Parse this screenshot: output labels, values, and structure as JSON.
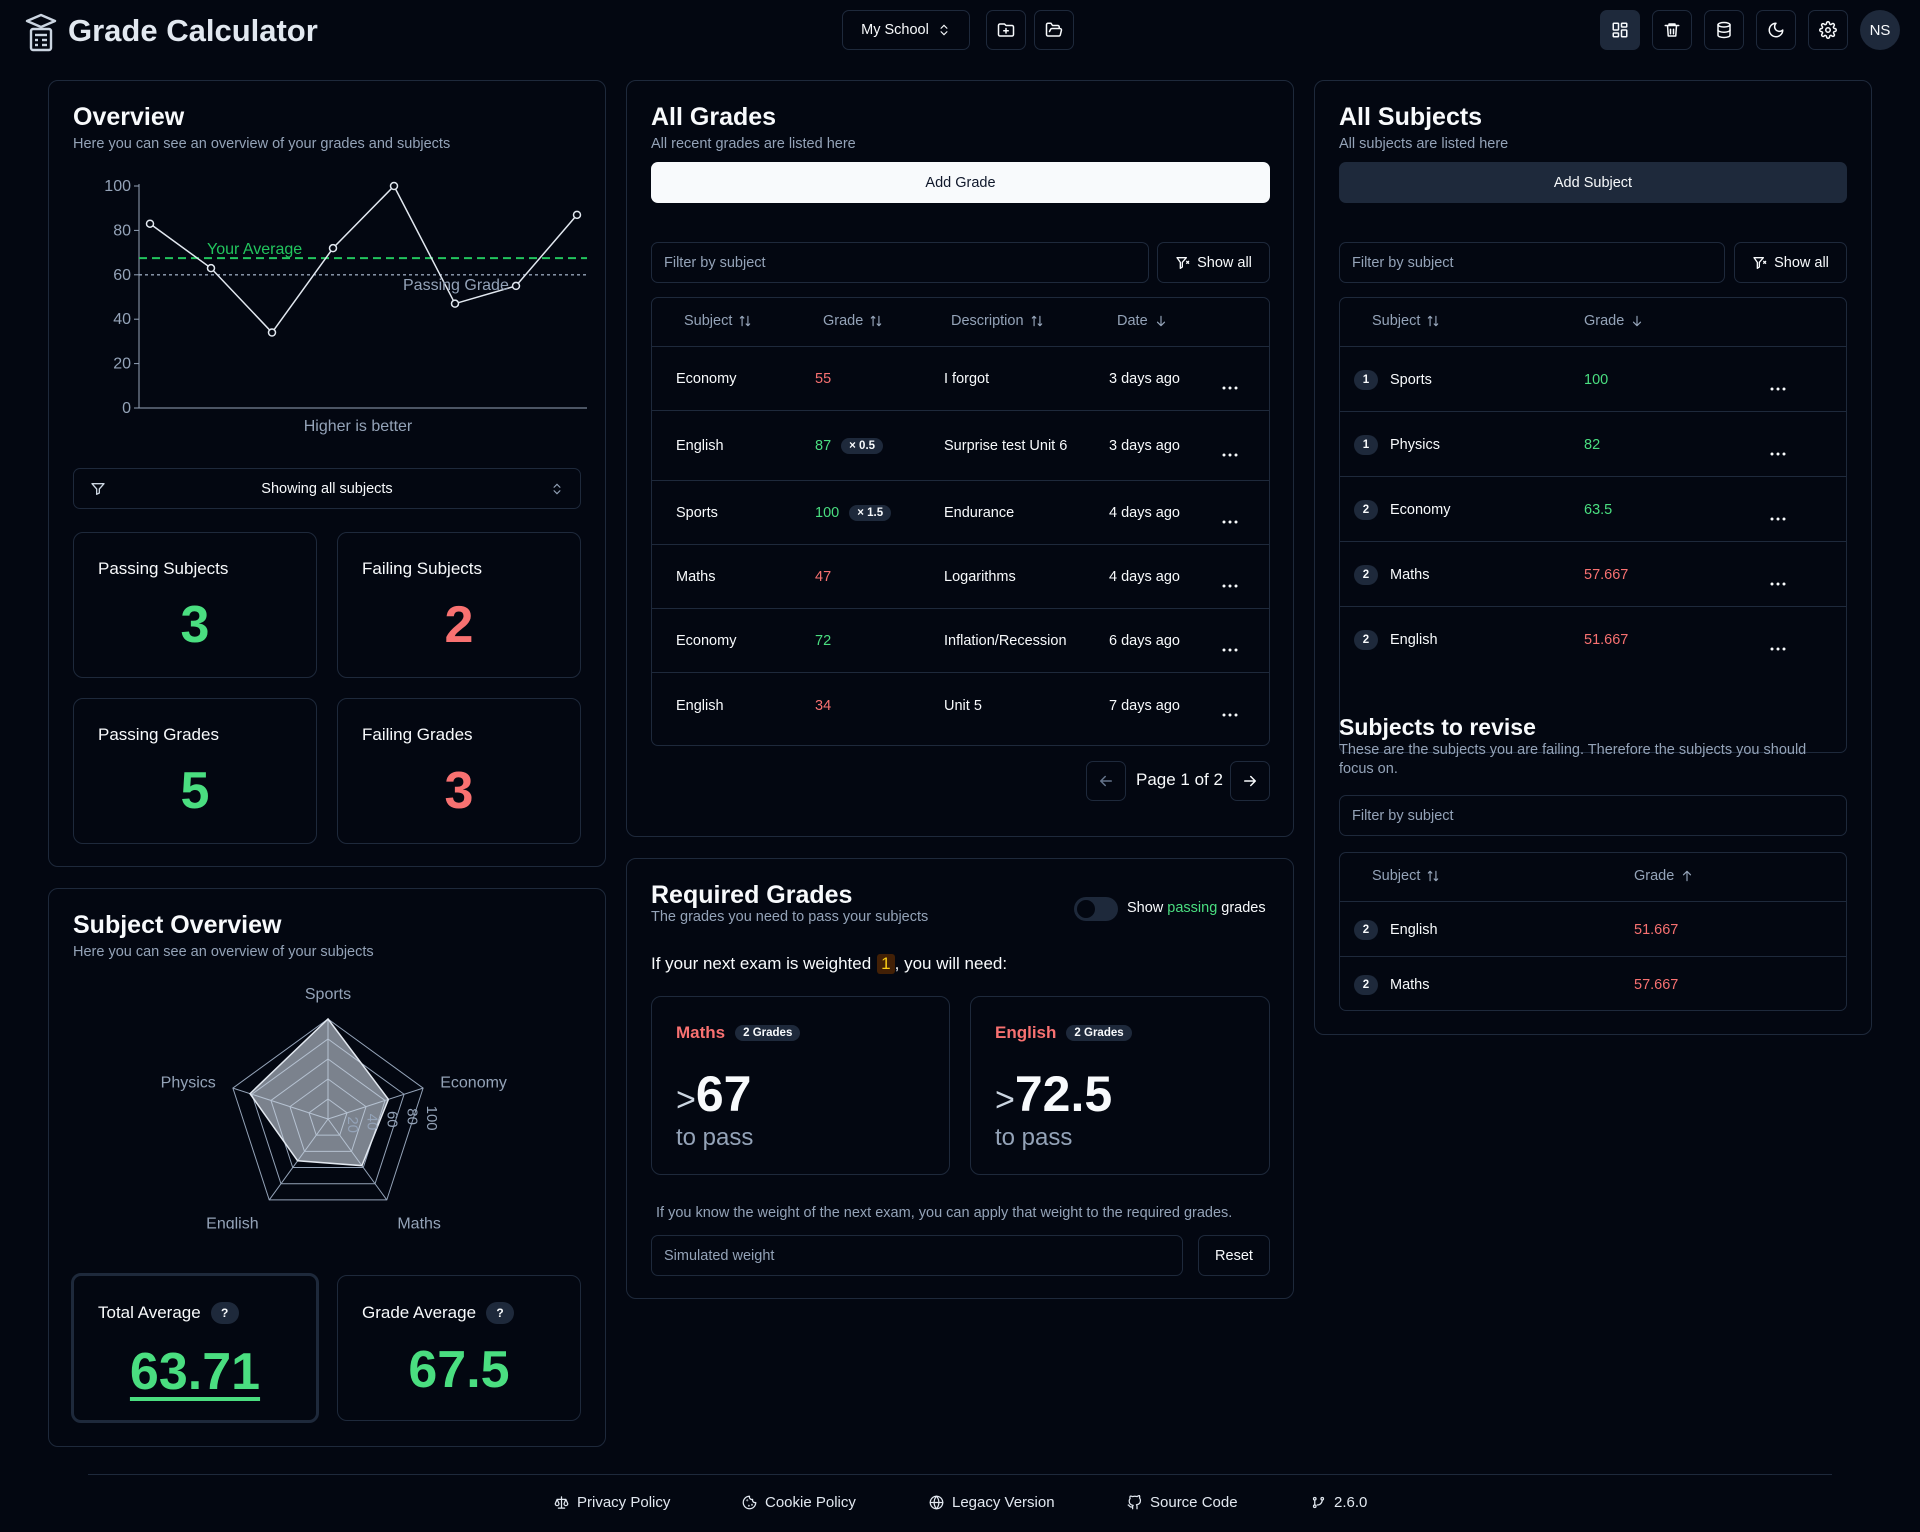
{
  "header": {
    "app_title": "Grade Calculator",
    "school_select": "My School",
    "user_initials": "NS"
  },
  "overview": {
    "title": "Overview",
    "subtitle": "Here you can see an overview of your grades and subjects",
    "filter_label": "Showing all subjects",
    "stats": {
      "passing_subjects_label": "Passing Subjects",
      "passing_subjects_value": "3",
      "failing_subjects_label": "Failing Subjects",
      "failing_subjects_value": "2",
      "passing_grades_label": "Passing Grades",
      "passing_grades_value": "5",
      "failing_grades_label": "Failing Grades",
      "failing_grades_value": "3"
    }
  },
  "chart_data": [
    {
      "type": "line",
      "y": [
        83,
        63,
        34,
        72,
        100,
        47,
        55,
        87
      ],
      "ylim": [
        0,
        100
      ],
      "yticks": [
        "100",
        "80",
        "60",
        "40",
        "20",
        "0"
      ],
      "xlabel": "Higher is better",
      "reference_lines": [
        {
          "name": "Your Average",
          "value": 67.5,
          "color": "#22c55e",
          "style": "dashed"
        },
        {
          "name": "Passing Grade",
          "value": 60,
          "color": "#94a3b8",
          "style": "dotted"
        }
      ],
      "grid": false
    },
    {
      "type": "radar",
      "categories": [
        "Sports",
        "Economy",
        "Maths",
        "English",
        "Physics"
      ],
      "values": [
        100,
        63.5,
        57.667,
        51.667,
        82
      ],
      "rlim": [
        0,
        100
      ],
      "rticks": [
        "20",
        "40",
        "60",
        "80",
        "100"
      ]
    }
  ],
  "subject_overview": {
    "title": "Subject Overview",
    "subtitle": "Here you can see an overview of your subjects",
    "total_average_label": "Total Average",
    "total_average_value": "63.71",
    "grade_average_label": "Grade Average",
    "grade_average_value": "67.5",
    "help_mark": "?"
  },
  "all_grades": {
    "title": "All Grades",
    "subtitle": "All recent grades are listed here",
    "add_button": "Add Grade",
    "filter_placeholder": "Filter by subject",
    "show_all": "Show all",
    "columns": [
      "Subject",
      "Grade",
      "Description",
      "Date"
    ],
    "rows": [
      {
        "subject": "Economy",
        "grade": "55",
        "weight": "",
        "description": "I forgot",
        "date": "3 days ago",
        "passing": false
      },
      {
        "subject": "English",
        "grade": "87",
        "weight": "× 0.5",
        "description": "Surprise test Unit 6",
        "date": "3 days ago",
        "passing": true
      },
      {
        "subject": "Sports",
        "grade": "100",
        "weight": "× 1.5",
        "description": "Endurance",
        "date": "4 days ago",
        "passing": true
      },
      {
        "subject": "Maths",
        "grade": "47",
        "weight": "",
        "description": "Logarithms",
        "date": "4 days ago",
        "passing": false
      },
      {
        "subject": "Economy",
        "grade": "72",
        "weight": "",
        "description": "Inflation/Recession",
        "date": "6 days ago",
        "passing": true
      },
      {
        "subject": "English",
        "grade": "34",
        "weight": "",
        "description": "Unit 5",
        "date": "7 days ago",
        "passing": false
      }
    ],
    "pagination": "Page 1 of 2"
  },
  "required_grades": {
    "title": "Required Grades",
    "subtitle": "The grades you need to pass your subjects",
    "toggle_prefix": "Show",
    "toggle_highlight": "passing",
    "toggle_suffix": "grades",
    "weight_text_before": "If your next exam is weighted",
    "weight_value": "1",
    "weight_text_after": ", you will need:",
    "cards": [
      {
        "subject": "Maths",
        "badge": "2 Grades",
        "value": "67",
        "caption": "to pass"
      },
      {
        "subject": "English",
        "badge": "2 Grades",
        "value": "72.5",
        "caption": "to pass"
      }
    ],
    "gt_symbol": ">",
    "hint": "If you know the weight of the next exam, you can apply that weight to the required grades.",
    "sim_placeholder": "Simulated weight",
    "reset": "Reset"
  },
  "all_subjects": {
    "title": "All Subjects",
    "subtitle": "All subjects are listed here",
    "add_button": "Add Subject",
    "filter_placeholder": "Filter by subject",
    "show_all": "Show all",
    "columns": [
      "Subject",
      "Grade"
    ],
    "rows": [
      {
        "count": "1",
        "subject": "Sports",
        "grade": "100",
        "passing": true
      },
      {
        "count": "1",
        "subject": "Physics",
        "grade": "82",
        "passing": true
      },
      {
        "count": "2",
        "subject": "Economy",
        "grade": "63.5",
        "passing": true
      },
      {
        "count": "2",
        "subject": "Maths",
        "grade": "57.667",
        "passing": false
      },
      {
        "count": "2",
        "subject": "English",
        "grade": "51.667",
        "passing": false
      }
    ]
  },
  "revise": {
    "title": "Subjects to revise",
    "subtitle": "These are the subjects you are failing. Therefore the subjects you should focus on.",
    "filter_placeholder": "Filter by subject",
    "columns": [
      "Subject",
      "Grade"
    ],
    "rows": [
      {
        "count": "2",
        "subject": "English",
        "grade": "51.667"
      },
      {
        "count": "2",
        "subject": "Maths",
        "grade": "57.667"
      }
    ]
  },
  "footer": {
    "privacy": "Privacy Policy",
    "cookie": "Cookie Policy",
    "legacy": "Legacy Version",
    "source": "Source Code",
    "version": "2.6.0"
  },
  "colors": {
    "background": "#030711",
    "border": "#1e293b",
    "pass": "#4ade80",
    "fail": "#f87171"
  }
}
